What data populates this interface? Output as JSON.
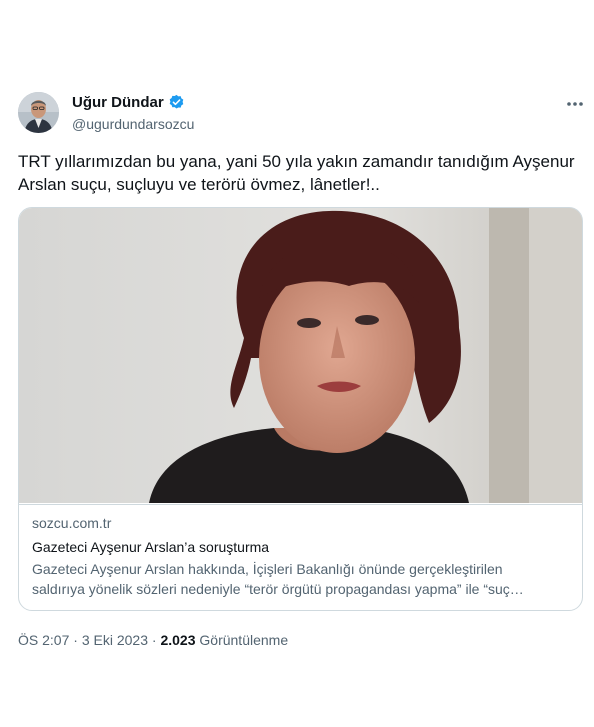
{
  "author": {
    "name": "Uğur Dündar",
    "handle": "@ugurdundarsozcu",
    "verified": true
  },
  "tweet": {
    "text": "TRT yıllarımızdan bu yana, yani 50 yıla yakın zamandır tanıdığım Ayşenur Arslan suçu, suçluyu ve terörü övmez, lânetler!.."
  },
  "link_card": {
    "domain": "sozcu.com.tr",
    "title": "Gazeteci Ayşenur Arslan’a soruşturma",
    "description_line1": "Gazeteci Ayşenur Arslan hakkında, İçişleri Bakanlığı önünde gerçekleştirilen",
    "description_line2": "saldırıya yönelik sözleri nedeniyle “terör örgütü propagandası yapma” ile “suç…"
  },
  "meta": {
    "time": "ÖS 2:07",
    "separator": " · ",
    "date": "3 Eki 2023",
    "views_count": "2.023",
    "views_label": "Görüntülenme"
  },
  "colors": {
    "verified_blue": "#1d9bf0",
    "text_primary": "#0f1419",
    "text_secondary": "#536471",
    "border": "#cfd9de"
  },
  "icons": [
    "verified-badge-icon",
    "more-options-icon"
  ]
}
